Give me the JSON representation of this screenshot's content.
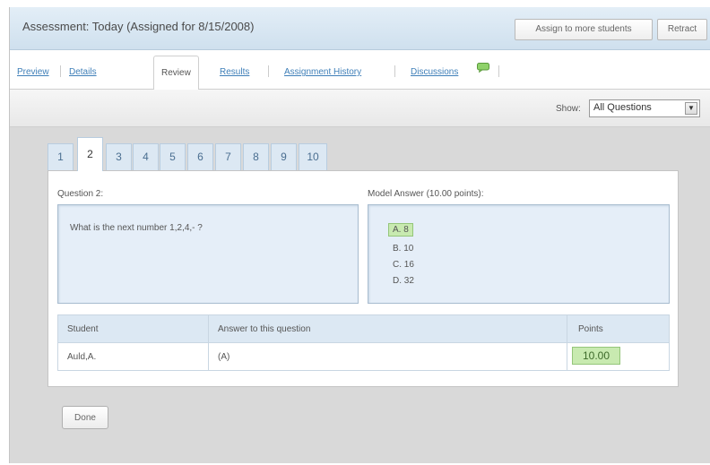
{
  "header": {
    "title": "Assessment: Today (Assigned for 8/15/2008)",
    "assign_button": "Assign to more students",
    "retract_button": "Retract"
  },
  "nav": {
    "tabs": [
      {
        "label": "Preview",
        "active": false
      },
      {
        "label": "Details",
        "active": false
      },
      {
        "label": "Review",
        "active": true
      },
      {
        "label": "Results",
        "active": false
      },
      {
        "label": "Assignment History",
        "active": false
      },
      {
        "label": "Discussions",
        "active": false
      }
    ],
    "discussion_icon": "chat-bubble-icon"
  },
  "filter": {
    "label": "Show:",
    "selected": "All Questions"
  },
  "question_tabs": [
    "1",
    "2",
    "3",
    "4",
    "5",
    "6",
    "7",
    "8",
    "9",
    "10"
  ],
  "active_question": "2",
  "question": {
    "label": "Question 2:",
    "text": "What is the next number 1,2,4,- ?"
  },
  "model_answer": {
    "label": "Model Answer (10.00 points):",
    "choices": [
      "A. 8",
      "B. 10",
      "C. 16",
      "D. 32"
    ],
    "correct_index": 0
  },
  "table": {
    "headers": {
      "student": "Student",
      "answer": "Answer to this question",
      "points": "Points"
    },
    "rows": [
      {
        "student": "Auld,A.",
        "answer": "(A)",
        "points": "10.00"
      }
    ]
  },
  "done_button": "Done",
  "colors": {
    "accent_link": "#3f7fb8",
    "header_bg": "#d6e5f2",
    "correct_highlight": "#c8eab0"
  }
}
